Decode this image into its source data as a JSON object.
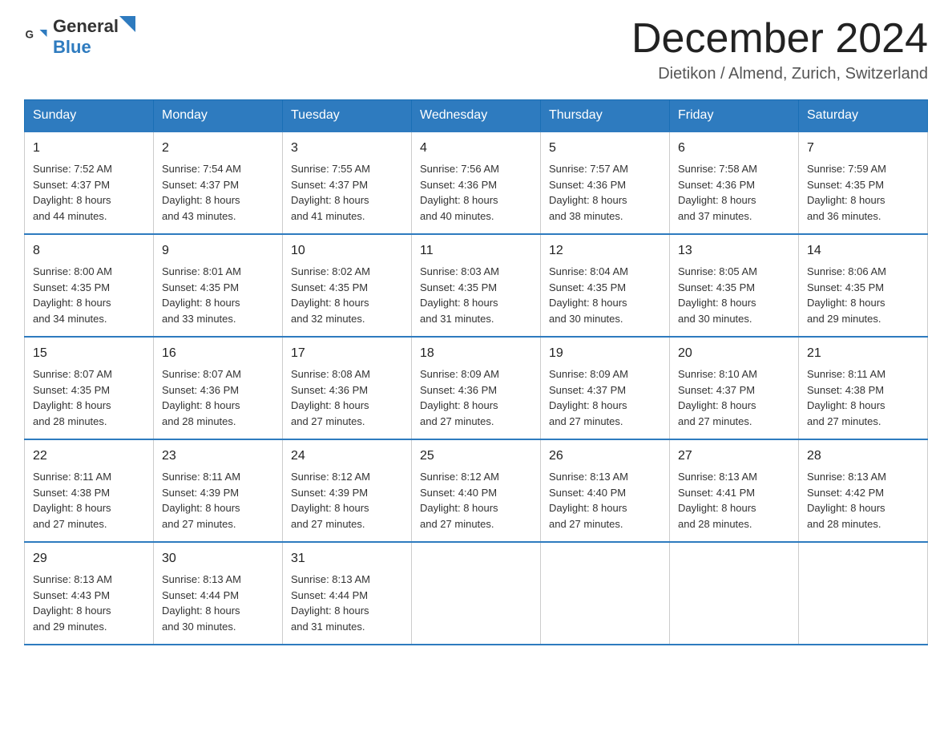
{
  "header": {
    "logo_general": "General",
    "logo_blue": "Blue",
    "title": "December 2024",
    "subtitle": "Dietikon / Almend, Zurich, Switzerland"
  },
  "days_of_week": [
    "Sunday",
    "Monday",
    "Tuesday",
    "Wednesday",
    "Thursday",
    "Friday",
    "Saturday"
  ],
  "weeks": [
    [
      {
        "day": "1",
        "sunrise": "7:52 AM",
        "sunset": "4:37 PM",
        "daylight": "8 hours and 44 minutes."
      },
      {
        "day": "2",
        "sunrise": "7:54 AM",
        "sunset": "4:37 PM",
        "daylight": "8 hours and 43 minutes."
      },
      {
        "day": "3",
        "sunrise": "7:55 AM",
        "sunset": "4:37 PM",
        "daylight": "8 hours and 41 minutes."
      },
      {
        "day": "4",
        "sunrise": "7:56 AM",
        "sunset": "4:36 PM",
        "daylight": "8 hours and 40 minutes."
      },
      {
        "day": "5",
        "sunrise": "7:57 AM",
        "sunset": "4:36 PM",
        "daylight": "8 hours and 38 minutes."
      },
      {
        "day": "6",
        "sunrise": "7:58 AM",
        "sunset": "4:36 PM",
        "daylight": "8 hours and 37 minutes."
      },
      {
        "day": "7",
        "sunrise": "7:59 AM",
        "sunset": "4:35 PM",
        "daylight": "8 hours and 36 minutes."
      }
    ],
    [
      {
        "day": "8",
        "sunrise": "8:00 AM",
        "sunset": "4:35 PM",
        "daylight": "8 hours and 34 minutes."
      },
      {
        "day": "9",
        "sunrise": "8:01 AM",
        "sunset": "4:35 PM",
        "daylight": "8 hours and 33 minutes."
      },
      {
        "day": "10",
        "sunrise": "8:02 AM",
        "sunset": "4:35 PM",
        "daylight": "8 hours and 32 minutes."
      },
      {
        "day": "11",
        "sunrise": "8:03 AM",
        "sunset": "4:35 PM",
        "daylight": "8 hours and 31 minutes."
      },
      {
        "day": "12",
        "sunrise": "8:04 AM",
        "sunset": "4:35 PM",
        "daylight": "8 hours and 30 minutes."
      },
      {
        "day": "13",
        "sunrise": "8:05 AM",
        "sunset": "4:35 PM",
        "daylight": "8 hours and 30 minutes."
      },
      {
        "day": "14",
        "sunrise": "8:06 AM",
        "sunset": "4:35 PM",
        "daylight": "8 hours and 29 minutes."
      }
    ],
    [
      {
        "day": "15",
        "sunrise": "8:07 AM",
        "sunset": "4:35 PM",
        "daylight": "8 hours and 28 minutes."
      },
      {
        "day": "16",
        "sunrise": "8:07 AM",
        "sunset": "4:36 PM",
        "daylight": "8 hours and 28 minutes."
      },
      {
        "day": "17",
        "sunrise": "8:08 AM",
        "sunset": "4:36 PM",
        "daylight": "8 hours and 27 minutes."
      },
      {
        "day": "18",
        "sunrise": "8:09 AM",
        "sunset": "4:36 PM",
        "daylight": "8 hours and 27 minutes."
      },
      {
        "day": "19",
        "sunrise": "8:09 AM",
        "sunset": "4:37 PM",
        "daylight": "8 hours and 27 minutes."
      },
      {
        "day": "20",
        "sunrise": "8:10 AM",
        "sunset": "4:37 PM",
        "daylight": "8 hours and 27 minutes."
      },
      {
        "day": "21",
        "sunrise": "8:11 AM",
        "sunset": "4:38 PM",
        "daylight": "8 hours and 27 minutes."
      }
    ],
    [
      {
        "day": "22",
        "sunrise": "8:11 AM",
        "sunset": "4:38 PM",
        "daylight": "8 hours and 27 minutes."
      },
      {
        "day": "23",
        "sunrise": "8:11 AM",
        "sunset": "4:39 PM",
        "daylight": "8 hours and 27 minutes."
      },
      {
        "day": "24",
        "sunrise": "8:12 AM",
        "sunset": "4:39 PM",
        "daylight": "8 hours and 27 minutes."
      },
      {
        "day": "25",
        "sunrise": "8:12 AM",
        "sunset": "4:40 PM",
        "daylight": "8 hours and 27 minutes."
      },
      {
        "day": "26",
        "sunrise": "8:13 AM",
        "sunset": "4:40 PM",
        "daylight": "8 hours and 27 minutes."
      },
      {
        "day": "27",
        "sunrise": "8:13 AM",
        "sunset": "4:41 PM",
        "daylight": "8 hours and 28 minutes."
      },
      {
        "day": "28",
        "sunrise": "8:13 AM",
        "sunset": "4:42 PM",
        "daylight": "8 hours and 28 minutes."
      }
    ],
    [
      {
        "day": "29",
        "sunrise": "8:13 AM",
        "sunset": "4:43 PM",
        "daylight": "8 hours and 29 minutes."
      },
      {
        "day": "30",
        "sunrise": "8:13 AM",
        "sunset": "4:44 PM",
        "daylight": "8 hours and 30 minutes."
      },
      {
        "day": "31",
        "sunrise": "8:13 AM",
        "sunset": "4:44 PM",
        "daylight": "8 hours and 31 minutes."
      },
      null,
      null,
      null,
      null
    ]
  ],
  "labels": {
    "sunrise": "Sunrise:",
    "sunset": "Sunset:",
    "daylight": "Daylight:"
  }
}
